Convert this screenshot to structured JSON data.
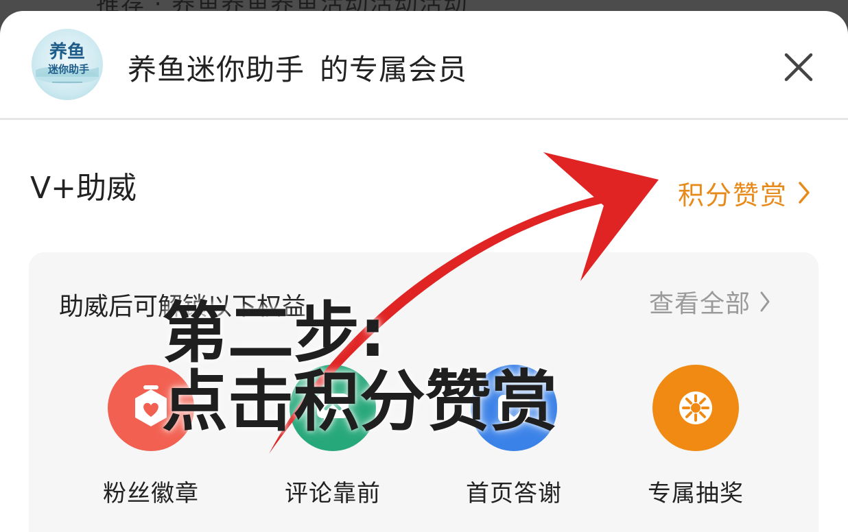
{
  "background": {
    "partial_text": "推荐 · 养鱼养鱼养鱼活动活动活动"
  },
  "header": {
    "app_name": "养鱼迷你助手",
    "title_suffix": "的专属会员",
    "avatar_text_line1": "养鱼",
    "avatar_text_line2": "迷你助手",
    "close_icon": "close-icon"
  },
  "member": {
    "name": "V+助威"
  },
  "reward_link": {
    "label": "积分赞赏",
    "icon": "chevron-right-icon",
    "color": "#e88a1a"
  },
  "benefits_card": {
    "title": "助威后可解锁以下权益",
    "view_all_label": "查看全部",
    "items": [
      {
        "label": "粉丝徽章",
        "icon": "badge-heart-icon",
        "color": "#f26051"
      },
      {
        "label": "评论靠前",
        "icon": "comment-top-icon",
        "color": "#27a87a"
      },
      {
        "label": "首页答谢",
        "icon": "thanks-heart-icon",
        "color": "#3b82e8"
      },
      {
        "label": "专属抽奖",
        "icon": "lottery-wheel-icon",
        "color": "#f08a12"
      }
    ]
  },
  "overlay": {
    "line1": "第二步:",
    "line2": "点击积分赞赏",
    "arrow_color": "#e02424"
  }
}
